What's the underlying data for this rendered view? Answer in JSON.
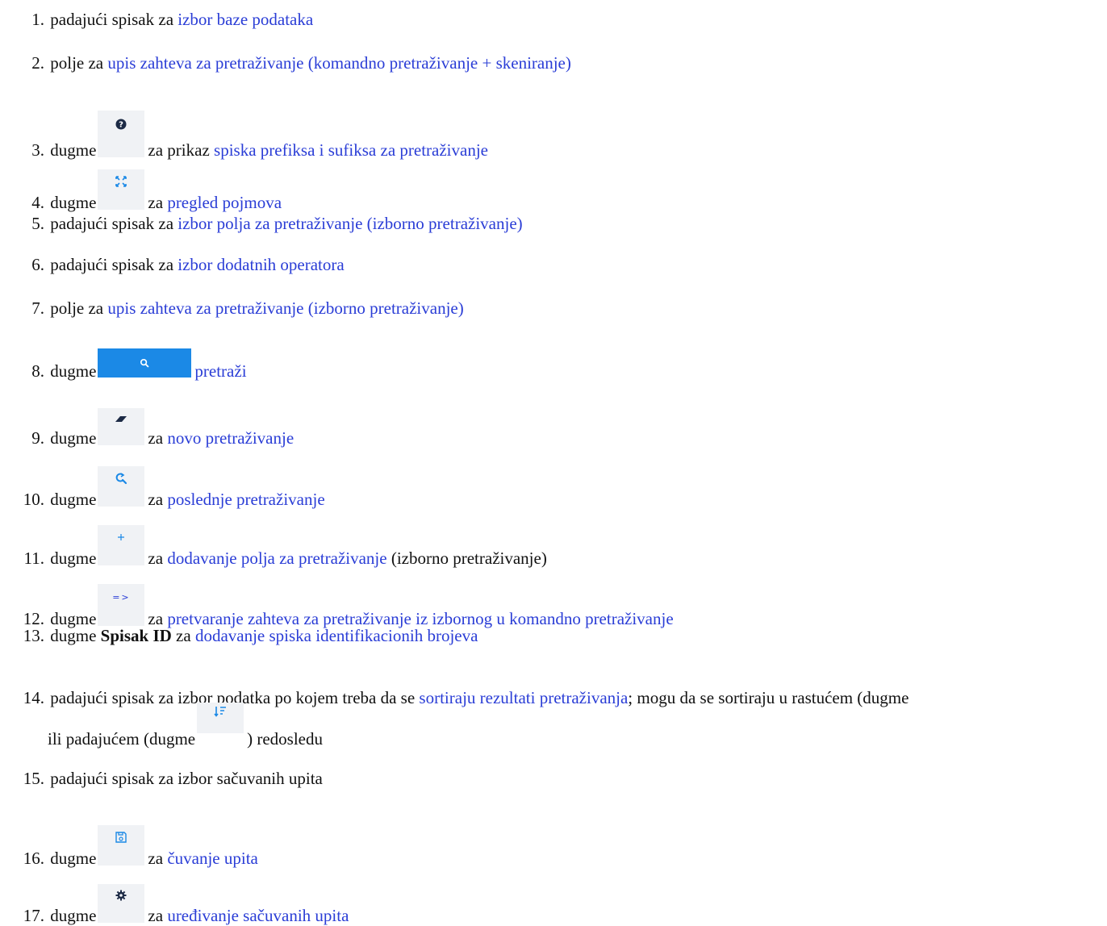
{
  "items": [
    {
      "num": "1.",
      "pre": "padajući spisak za",
      "link": "izbor baze podataka"
    },
    {
      "num": "2.",
      "pre": "polje za",
      "link": "upis zahteva za pretraživanje (komandno pretraživanje + skeniranje)"
    },
    {
      "num": "3.",
      "pre": "dugme",
      "icon": "question-circle-icon",
      "mid": "za prikaz",
      "link": "spiska prefiksa i sufiksa za pretraživanje"
    },
    {
      "num": "4.",
      "pre": "dugme",
      "icon": "expand-arrows-icon",
      "mid": "za",
      "link": "pregled pojmova"
    },
    {
      "num": "5.",
      "pre": "padajući spisak za",
      "link": "izbor polja za pretraživanje (izborno pretraživanje)"
    },
    {
      "num": "6.",
      "pre": "padajući spisak za",
      "link": "izbor dodatnih operatora"
    },
    {
      "num": "7.",
      "pre": "polje za",
      "link": "upis zahteva za pretraživanje (izborno pretraživanje)"
    },
    {
      "num": "8.",
      "pre": "dugme",
      "icon": "search-icon",
      "link": "pretraži"
    },
    {
      "num": "9.",
      "pre": "dugme",
      "icon": "eraser-icon",
      "mid": "za",
      "link": "novo pretraživanje"
    },
    {
      "num": "10.",
      "pre": "dugme",
      "icon": "search-history-icon",
      "mid": "za",
      "link": "poslednje pretraživanje"
    },
    {
      "num": "11.",
      "pre": "dugme",
      "icon": "plus-icon",
      "mid": "za",
      "link": "dodavanje polja za pretraživanje",
      "post": "(izborno pretraživanje)"
    },
    {
      "num": "12.",
      "pre": "dugme",
      "icon_text": "=>",
      "mid": "za",
      "link": "pretvaranje zahteva za pretraživanje iz izbornog u komandno pretraživanje"
    },
    {
      "num": "13.",
      "pre": "dugme",
      "bold": "Spisak ID",
      "mid": "za",
      "link": "dodavanje spiska identifikacionih brojeva"
    },
    {
      "num": "14.",
      "pre": "padajući spisak za izbor podatka po kojem treba da se",
      "link": "sortiraju rezultati pretraživanja",
      "post": "; mogu da se sortiraju u rastućem (dugme",
      "line2_pre": "ili padajućem (dugme",
      "line2_icon": "sort-descending-icon",
      "line2_post": ") redosledu"
    },
    {
      "num": "15.",
      "pre": "padajući spisak za izbor sačuvanih upita"
    },
    {
      "num": "16.",
      "pre": "dugme",
      "icon": "save-query-icon",
      "mid": "za",
      "link": "čuvanje upita"
    },
    {
      "num": "17.",
      "pre": "dugme",
      "icon": "gear-icon",
      "mid": "za",
      "link": "uređivanje sačuvanih upita"
    }
  ]
}
